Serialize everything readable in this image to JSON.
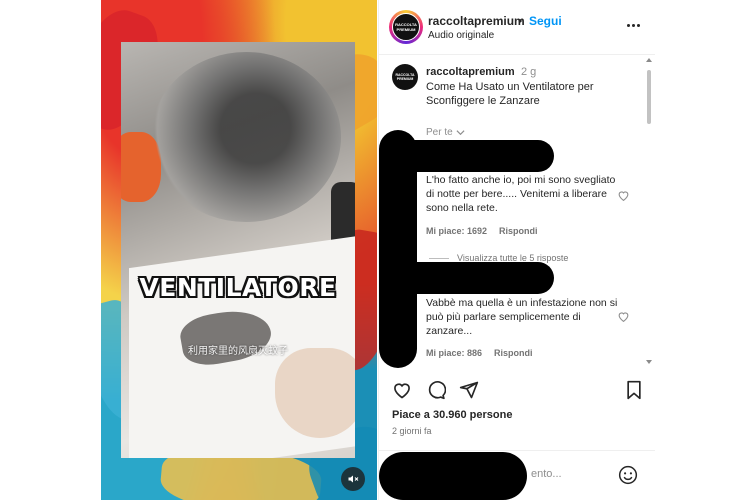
{
  "video": {
    "overlay_title": "VENTILATORE",
    "overlay_subtitle": "利用家里的风扇灭蚊子"
  },
  "header": {
    "username": "raccoltapremium",
    "separator": "•",
    "follow_label": "Segui",
    "audio_label": "Audio originale",
    "avatar_text": "RACCOLTA PREMIUM"
  },
  "caption": {
    "username": "raccoltapremium",
    "time": "2 g",
    "text": "Come Ha Usato un Ventilatore per Sconfiggere le Zanzare",
    "avatar_text": "RACCOLTA PREMIUM"
  },
  "for_you_label": "Per te",
  "comments": [
    {
      "text": "L'ho fatto anche io, poi mi sono svegliato di notte per bere..... Venitemi a liberare sono nella rete.",
      "likes": "Mi piace: 1692",
      "reply_label": "Rispondi"
    },
    {
      "text": "Vabbè ma quella è un infestazione non si può più parlare semplicemente di zanzare...",
      "likes": "Mi piace: 886",
      "reply_label": "Rispondi"
    }
  ],
  "view_replies_label": "Visualizza tutte le 5 risposte",
  "likes_summary": "Piace a 30.960 persone",
  "posted_ago": "2 giorni fa",
  "comment_placeholder_visible": "ento..."
}
